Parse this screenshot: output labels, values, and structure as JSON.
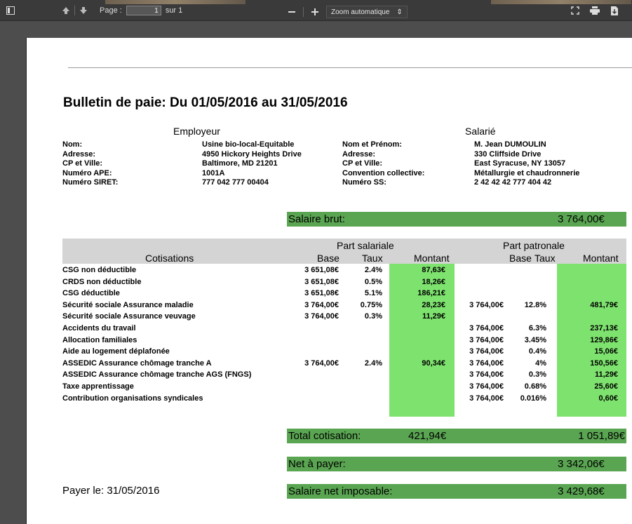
{
  "toolbar": {
    "page_label": "Page :",
    "page_value": "1",
    "page_total": "sur 1",
    "zoom_label": "Zoom automatique",
    "icons": [
      "sidebar-toggle-icon",
      "arrow-up-icon",
      "arrow-down-icon",
      "minus-icon",
      "plus-icon",
      "fullscreen-icon",
      "print-icon",
      "download-icon"
    ]
  },
  "doc": {
    "title": "Bulletin de paie: Du 01/05/2016 au 31/05/2016",
    "employer_heading": "Employeur",
    "employee_heading": "Salarié",
    "employer": [
      {
        "label": "Nom:",
        "value": "Usine bio-local-Equitable"
      },
      {
        "label": "Adresse:",
        "value": "4950 Hickory Heights Drive"
      },
      {
        "label": "CP et Ville:",
        "value": "Baltimore, MD 21201"
      },
      {
        "label": "Numéro APE:",
        "value": "1001A"
      },
      {
        "label": "Numéro SIRET:",
        "value": "777 042 777 00404"
      }
    ],
    "employee": [
      {
        "label": "Nom et Prénom:",
        "value": "M. Jean DUMOULIN"
      },
      {
        "label": "Adresse:",
        "value": "330 Cliffside Drive"
      },
      {
        "label": "CP et Ville:",
        "value": "East Syracuse, NY 13057"
      },
      {
        "label": "Convention collective:",
        "value": "Métallurgie et chaudronnerie"
      },
      {
        "label": "Numéro SS:",
        "value": "2 42 42 42 777 404 42"
      }
    ],
    "salaire_brut_label": "Salaire brut:",
    "salaire_brut_value": "3 764,00€",
    "table_headers": {
      "part_salariale": "Part salariale",
      "part_patronale": "Part patronale",
      "cotisations": "Cotisations",
      "base": "Base",
      "taux": "Taux",
      "montant": "Montant"
    },
    "rows": [
      {
        "name": "CSG non déductible",
        "sb": "3 651,08€",
        "st": "2.4%",
        "sm": "87,63€",
        "pb": "",
        "pt": "",
        "pm": ""
      },
      {
        "name": "CRDS non déductible",
        "sb": "3 651,08€",
        "st": "0.5%",
        "sm": "18,26€",
        "pb": "",
        "pt": "",
        "pm": ""
      },
      {
        "name": "CSG déductible",
        "sb": "3 651,08€",
        "st": "5.1%",
        "sm": "186,21€",
        "pb": "",
        "pt": "",
        "pm": ""
      },
      {
        "name": "Sécurité sociale Assurance maladie",
        "sb": "3 764,00€",
        "st": "0.75%",
        "sm": "28,23€",
        "pb": "3 764,00€",
        "pt": "12.8%",
        "pm": "481,79€"
      },
      {
        "name": "Sécurité sociale Assurance veuvage",
        "sb": "3 764,00€",
        "st": "0.3%",
        "sm": "11,29€",
        "pb": "",
        "pt": "",
        "pm": ""
      },
      {
        "name": "Accidents du travail",
        "sb": "",
        "st": "",
        "sm": "",
        "pb": "3 764,00€",
        "pt": "6.3%",
        "pm": "237,13€"
      },
      {
        "name": "Allocation familiales",
        "sb": "",
        "st": "",
        "sm": "",
        "pb": "3 764,00€",
        "pt": "3.45%",
        "pm": "129,86€"
      },
      {
        "name": "Aide au logement déplafonée",
        "sb": "",
        "st": "",
        "sm": "",
        "pb": "3 764,00€",
        "pt": "0.4%",
        "pm": "15,06€"
      },
      {
        "name": "ASSEDIC Assurance chômage tranche A",
        "sb": "3 764,00€",
        "st": "2.4%",
        "sm": "90,34€",
        "pb": "3 764,00€",
        "pt": "4%",
        "pm": "150,56€"
      },
      {
        "name": "ASSEDIC Assurance chômage tranche AGS (FNGS)",
        "sb": "",
        "st": "",
        "sm": "",
        "pb": "3 764,00€",
        "pt": "0.3%",
        "pm": "11,29€"
      },
      {
        "name": "Taxe apprentissage",
        "sb": "",
        "st": "",
        "sm": "",
        "pb": "3 764,00€",
        "pt": "0.68%",
        "pm": "25,60€"
      },
      {
        "name": "Contribution organisations syndicales",
        "sb": "",
        "st": "",
        "sm": "",
        "pb": "3 764,00€",
        "pt": "0.016%",
        "pm": "0,60€"
      }
    ],
    "total_label": "Total cotisation:",
    "total_salariale": "421,94€",
    "total_patronale": "1 051,89€",
    "net_label": "Net à payer:",
    "net_value": "3 342,06€",
    "imposable_label": "Salaire net imposable:",
    "imposable_value": "3 429,68€",
    "payer_le": "Payer le: 31/05/2016",
    "colors": {
      "green_bar": "#5aa552",
      "green_cell": "#7ee36e",
      "header_gray": "#d4d4d4"
    }
  }
}
